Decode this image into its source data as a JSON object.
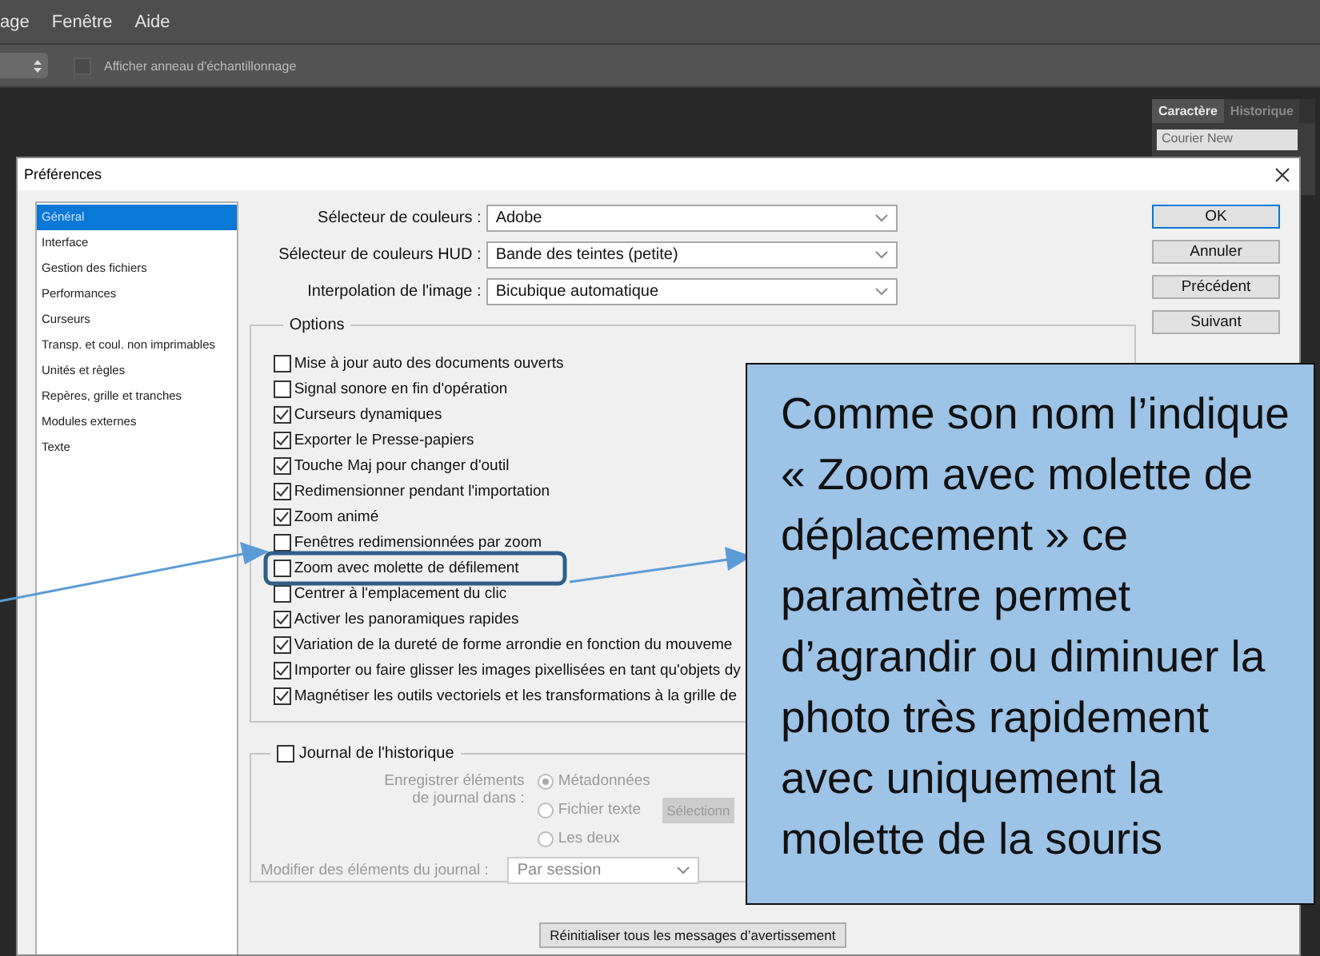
{
  "menu_bar": {
    "items": [
      "age",
      "Fenêtre",
      "Aide"
    ]
  },
  "options_bar": {
    "sampling_ring": {
      "label": "Afficher anneau d'échantillonnage",
      "checked": false
    }
  },
  "panel": {
    "tabs": [
      {
        "label": "Caractère",
        "selected": true
      },
      {
        "label": "Historique",
        "selected": false
      }
    ],
    "font_field": "Courier New"
  },
  "dialog": {
    "title": "Préférences",
    "sidebar": [
      {
        "label": "Général",
        "selected": true
      },
      {
        "label": "Interface",
        "selected": false
      },
      {
        "label": "Gestion des fichiers",
        "selected": false
      },
      {
        "label": "Performances",
        "selected": false
      },
      {
        "label": "Curseurs",
        "selected": false
      },
      {
        "label": "Transp. et coul. non imprimables",
        "selected": false
      },
      {
        "label": "Unités et règles",
        "selected": false
      },
      {
        "label": "Repères, grille et tranches",
        "selected": false
      },
      {
        "label": "Modules externes",
        "selected": false
      },
      {
        "label": "Texte",
        "selected": false
      }
    ],
    "selects": [
      {
        "label": "Sélecteur de couleurs :",
        "value": "Adobe"
      },
      {
        "label": "Sélecteur de couleurs HUD :",
        "value": "Bande des teintes (petite)"
      },
      {
        "label": "Interpolation de l'image :",
        "value": "Bicubique automatique"
      }
    ],
    "options_legend": "Options",
    "options": [
      {
        "label": "Mise à jour auto des documents ouverts",
        "checked": false
      },
      {
        "label": "Signal sonore en fin d'opération",
        "checked": false
      },
      {
        "label": "Curseurs dynamiques",
        "checked": true
      },
      {
        "label": "Exporter le Presse-papiers",
        "checked": true
      },
      {
        "label": "Touche Maj pour changer d'outil",
        "checked": true
      },
      {
        "label": "Redimensionner pendant l'importation",
        "checked": true
      },
      {
        "label": "Zoom animé",
        "checked": true
      },
      {
        "label": "Fenêtres redimensionnées par zoom",
        "checked": false
      },
      {
        "label": "Zoom avec molette de défilement",
        "checked": false
      },
      {
        "label": "Centrer à l'emplacement du clic",
        "checked": false
      },
      {
        "label": "Activer les panoramiques rapides",
        "checked": true
      },
      {
        "label": "Variation de la dureté de forme arrondie en fonction du mouveme",
        "checked": true
      },
      {
        "label": "Importer ou faire glisser les images pixellisées en tant qu'objets dy",
        "checked": true
      },
      {
        "label": "Magnétiser les outils vectoriels et les transformations à la grille de",
        "checked": true
      }
    ],
    "buttons": [
      {
        "label": "OK",
        "default": true
      },
      {
        "label": "Annuler",
        "default": false
      },
      {
        "label": "Précédent",
        "default": false
      },
      {
        "label": "Suivant",
        "default": false
      }
    ],
    "history": {
      "label": "Journal de l'historique",
      "checked": false,
      "save_label": [
        "Enregistrer éléments",
        "de journal dans :"
      ],
      "radios": [
        {
          "label": "Métadonnées",
          "selected": true
        },
        {
          "label": "Fichier texte",
          "selected": false
        },
        {
          "label": "Les deux",
          "selected": false
        }
      ],
      "choose_button": "Sélectionn",
      "edit_label": "Modifier des éléments du journal :",
      "edit_value": "Par session"
    },
    "reset_button": "Réinitialiser tous les messages d’avertissement"
  },
  "annotation": {
    "callout_lines": [
      "Comme son nom l’indique",
      "« Zoom avec molette de",
      "déplacement » ce",
      "paramètre permet",
      "d’agrandir ou diminuer la",
      "photo très rapidement",
      "avec uniquement la",
      "molette de la souris"
    ]
  }
}
